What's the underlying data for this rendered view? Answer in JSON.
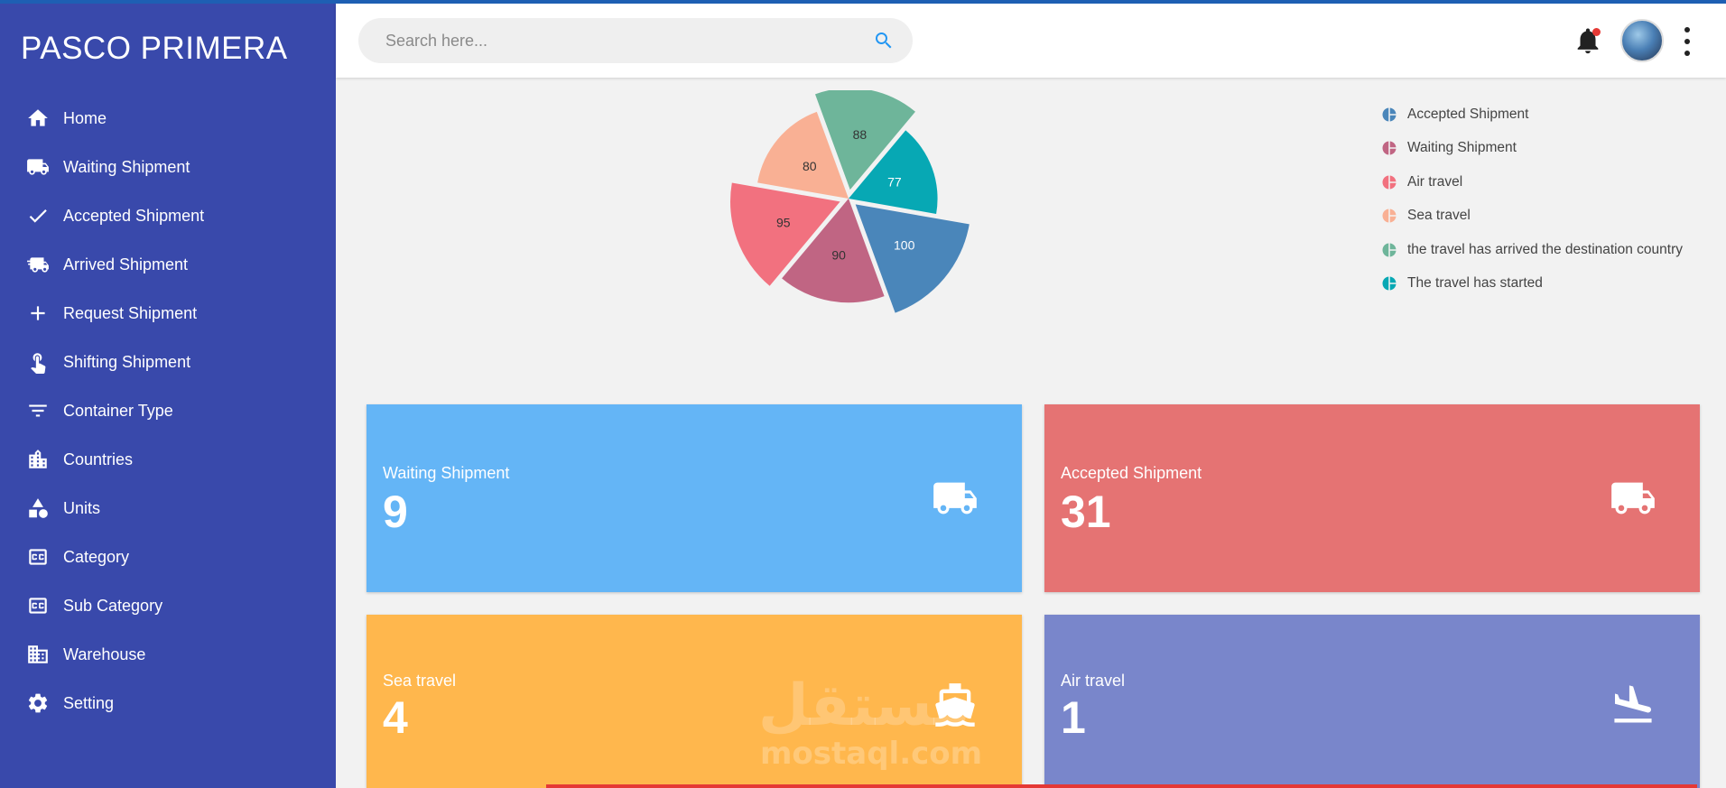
{
  "app": {
    "brand": "PASCO PRIMERA"
  },
  "sidebar": {
    "items": [
      {
        "label": "Home",
        "icon": "home-icon"
      },
      {
        "label": "Waiting Shipment",
        "icon": "truck-icon"
      },
      {
        "label": "Accepted Shipment",
        "icon": "check-icon"
      },
      {
        "label": "Arrived Shipment",
        "icon": "fast-truck-icon"
      },
      {
        "label": "Request Shipment",
        "icon": "plus-icon"
      },
      {
        "label": "Shifting Shipment",
        "icon": "tap-hand-icon"
      },
      {
        "label": "Container Type",
        "icon": "filter-icon"
      },
      {
        "label": "Countries",
        "icon": "city-icon"
      },
      {
        "label": "Units",
        "icon": "shapes-icon"
      },
      {
        "label": "Category",
        "icon": "cc-icon"
      },
      {
        "label": "Sub Category",
        "icon": "cc-icon"
      },
      {
        "label": "Warehouse",
        "icon": "building-icon"
      },
      {
        "label": "Setting",
        "icon": "gear-icon"
      }
    ]
  },
  "topbar": {
    "search_placeholder": "Search here...",
    "search_value": ""
  },
  "chart_data": {
    "type": "pie",
    "title": "",
    "slices": [
      {
        "label": "Accepted Shipment",
        "value": 100,
        "color": "#4a86ba",
        "exploded": true
      },
      {
        "label": "Waiting Shipment",
        "value": 90,
        "color": "#c06583",
        "exploded": false
      },
      {
        "label": "Air travel",
        "value": 95,
        "color": "#f2717f",
        "exploded": true
      },
      {
        "label": "Sea travel",
        "value": 80,
        "color": "#f9b094",
        "exploded": false
      },
      {
        "label": "the travel has arrived the destination country",
        "value": 88,
        "color": "#6eb59a",
        "exploded": true
      },
      {
        "label": "The travel has started",
        "value": 77,
        "color": "#07a8b4",
        "exploded": false
      }
    ],
    "legend_position": "top-right"
  },
  "cards": [
    {
      "title": "Waiting Shipment",
      "value": "9",
      "icon": "truck-icon",
      "color": "#64b5f6"
    },
    {
      "title": "Accepted Shipment",
      "value": "31",
      "icon": "truck-icon",
      "color": "#e57373"
    },
    {
      "title": "Sea travel",
      "value": "4",
      "icon": "ship-icon",
      "color": "#ffb74d"
    },
    {
      "title": "Air travel",
      "value": "1",
      "icon": "plane-landing-icon",
      "color": "#7986cb"
    }
  ],
  "watermark": {
    "arabic": "مستقل",
    "latin": "mostaql.com"
  }
}
